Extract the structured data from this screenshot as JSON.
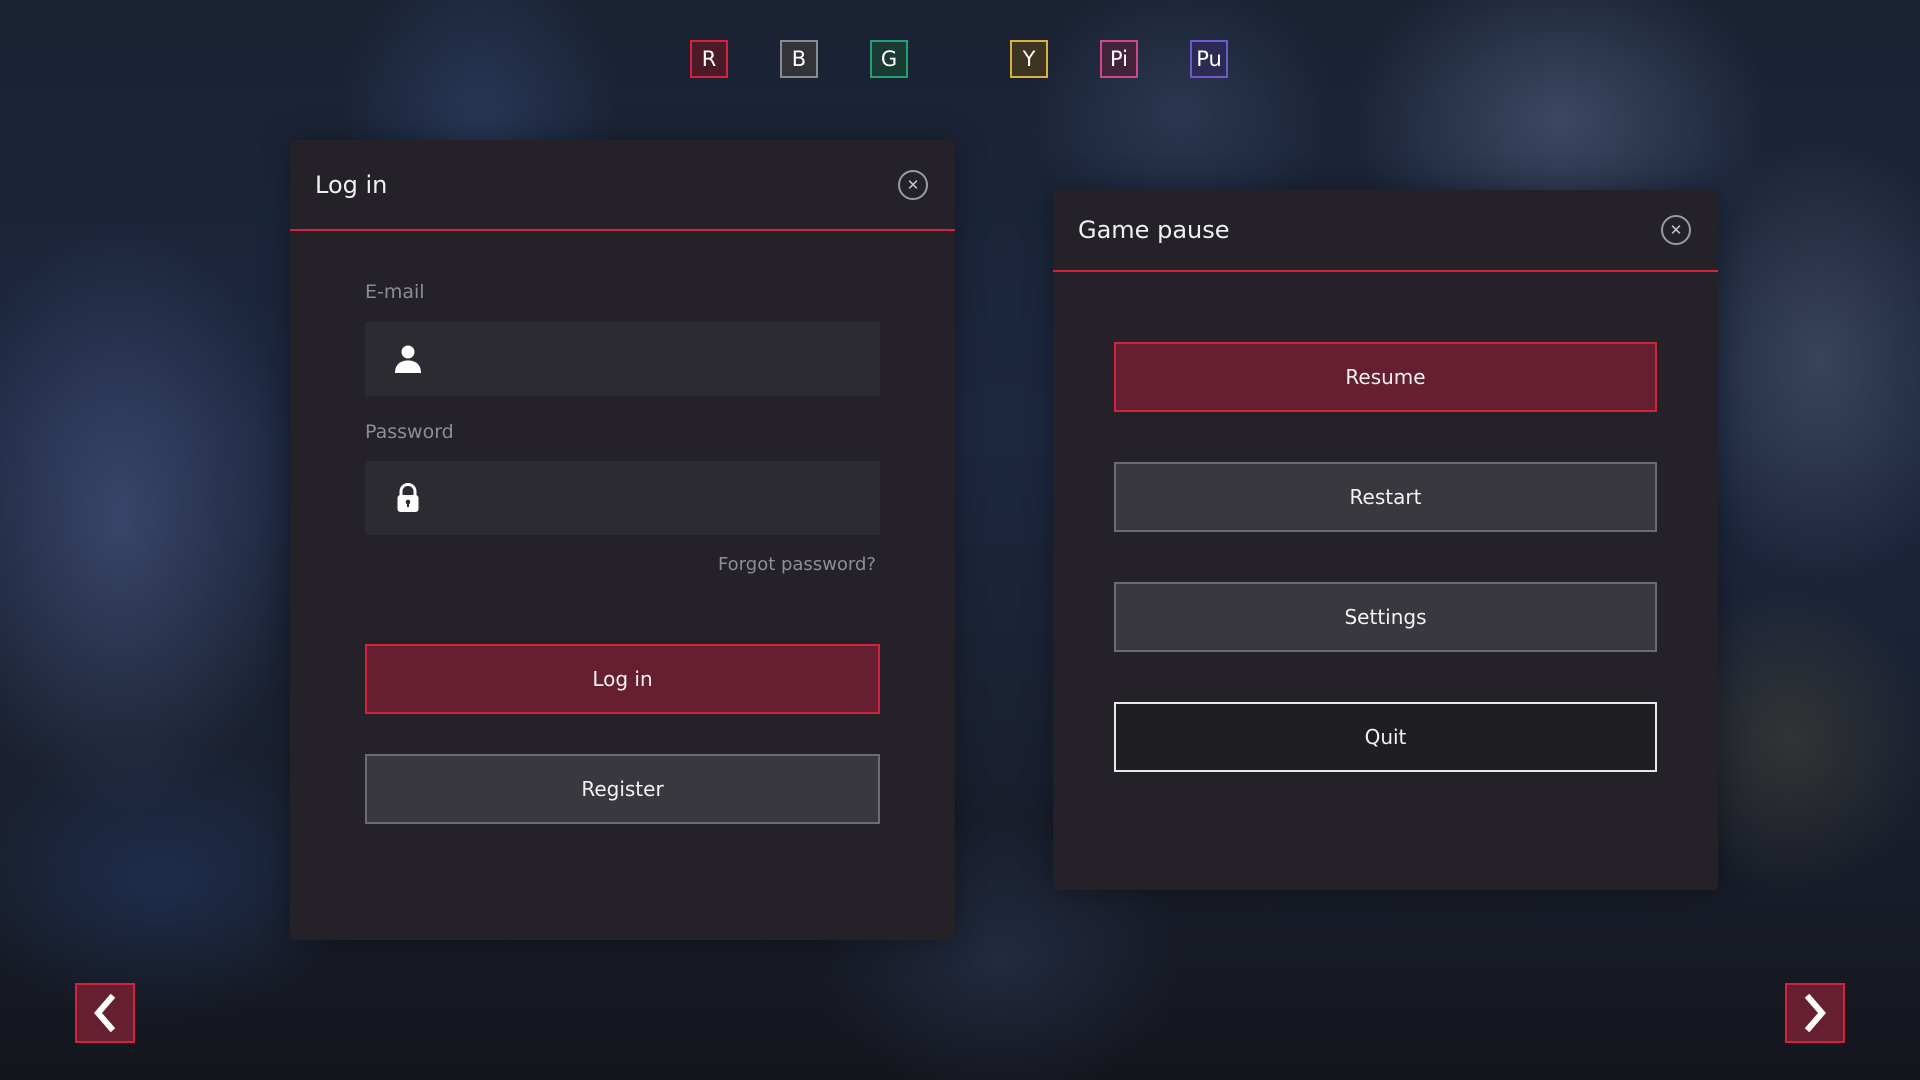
{
  "swatches": [
    {
      "label": "R",
      "color": "#d4213d",
      "fill": "#4a1a26"
    },
    {
      "label": "B",
      "color": "#8a8a92",
      "fill": "#33333a"
    },
    {
      "label": "G",
      "color": "#23a074",
      "fill": "#1a3b33"
    },
    {
      "label": "Y",
      "color": "#d8b23a",
      "fill": "#3d3522"
    },
    {
      "label": "Pi",
      "color": "#cc4a86",
      "fill": "#43223a"
    },
    {
      "label": "Pu",
      "color": "#6a5cc9",
      "fill": "#2c2a55"
    }
  ],
  "login": {
    "title": "Log in",
    "close_icon": "close-icon",
    "email_label": "E-mail",
    "email_value": "",
    "email_icon": "user-icon",
    "password_label": "Password",
    "password_value": "",
    "password_icon": "lock-icon",
    "forgot_label": "Forgot password?",
    "login_label": "Log in",
    "register_label": "Register"
  },
  "pause": {
    "title": "Game pause",
    "close_icon": "close-icon",
    "resume_label": "Resume",
    "restart_label": "Restart",
    "settings_label": "Settings",
    "quit_label": "Quit"
  },
  "nav": {
    "prev_icon": "chevron-left-icon",
    "next_icon": "chevron-right-icon"
  },
  "colors": {
    "accent": "#d4213d",
    "primary_fill": "#661f30",
    "panel_bg": "#242228",
    "secondary_fill": "#3a383f"
  }
}
